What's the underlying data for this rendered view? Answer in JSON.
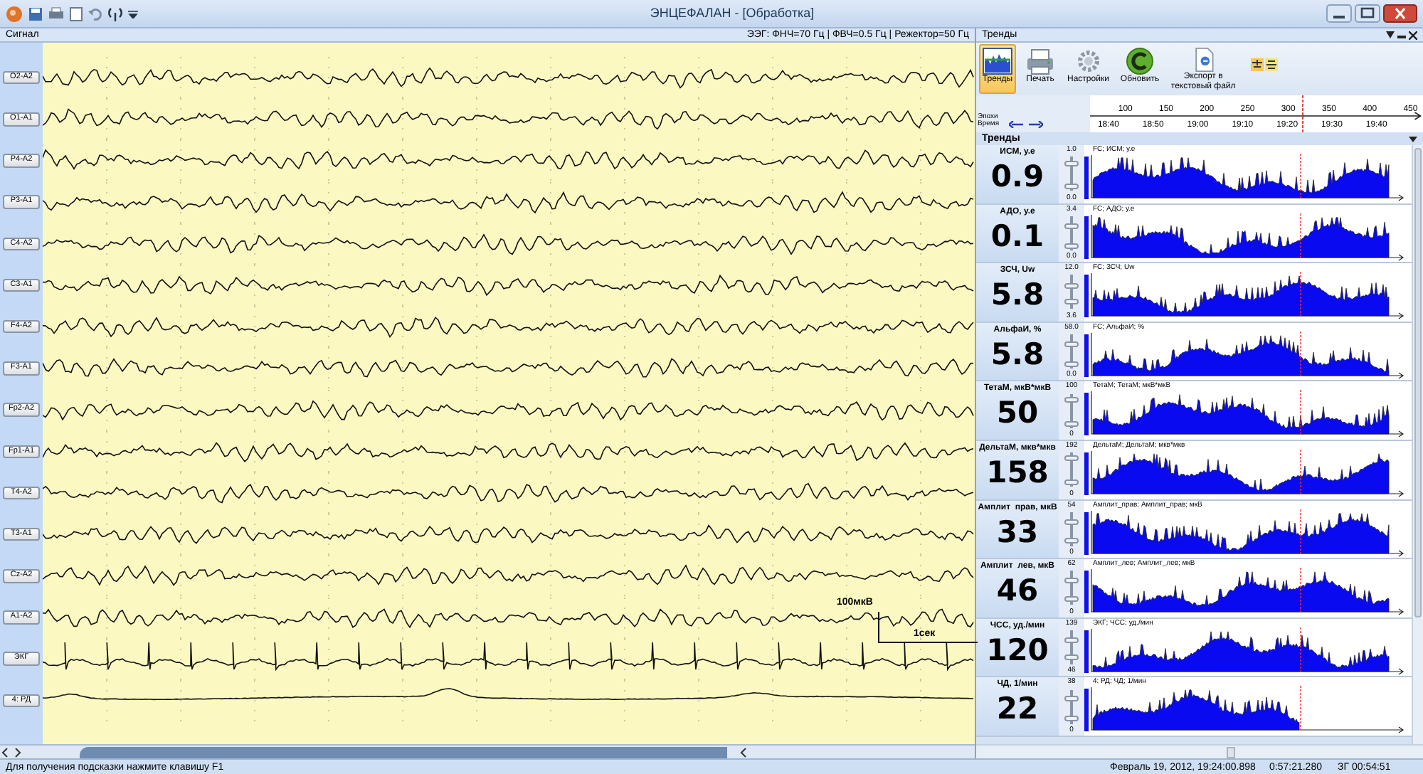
{
  "window": {
    "title": "ЭНЦЕФАЛАН - [Обработка]"
  },
  "signal_panel": {
    "title": "Сигнал",
    "filters": "ЭЭГ: ФНЧ=70 Гц | ФВЧ=0.5 Гц | Режектор=50 Гц",
    "channels": [
      {
        "label": "O2-A2",
        "kind": "eeg"
      },
      {
        "label": "O1-A1",
        "kind": "eeg"
      },
      {
        "label": "P4-A2",
        "kind": "eeg"
      },
      {
        "label": "P3-A1",
        "kind": "eeg"
      },
      {
        "label": "C4-A2",
        "kind": "eeg"
      },
      {
        "label": "C3-A1",
        "kind": "eeg"
      },
      {
        "label": "F4-A2",
        "kind": "eeg"
      },
      {
        "label": "F3-A1",
        "kind": "eeg"
      },
      {
        "label": "Fp2-A2",
        "kind": "eeg"
      },
      {
        "label": "Fp1-A1",
        "kind": "eeg"
      },
      {
        "label": "T4-A2",
        "kind": "eeg"
      },
      {
        "label": "T3-A1",
        "kind": "eeg"
      },
      {
        "label": "Cz-A2",
        "kind": "eeg"
      },
      {
        "label": "A1-A2",
        "kind": "eeg"
      },
      {
        "label": "ЭКГ",
        "kind": "ecg"
      },
      {
        "label": "4: РД",
        "kind": "resp"
      }
    ],
    "scale_amplitude": "100мкВ",
    "scale_time": "1сек"
  },
  "trends_panel": {
    "title": "Тренды",
    "toolbar": [
      {
        "label": "Тренды",
        "kind": "trends",
        "selected": true
      },
      {
        "label": "Печать",
        "kind": "print",
        "selected": false
      },
      {
        "label": "Настройки",
        "kind": "settings",
        "selected": false
      },
      {
        "label": "Обновить",
        "kind": "refresh",
        "selected": false
      },
      {
        "label": "Экспорт в текстовый файл",
        "kind": "export",
        "selected": false
      }
    ],
    "ruler": {
      "epochs_label": "Эпохи",
      "time_label": "Время",
      "epochs": [
        "100",
        "150",
        "200",
        "250",
        "300",
        "350",
        "400",
        "450"
      ],
      "times": [
        "18:40",
        "18:50",
        "19:00",
        "19:10",
        "19:20",
        "19:30",
        "19:40"
      ]
    },
    "section_title": "Тренды",
    "trends": [
      {
        "name": "ИСМ, у.е",
        "value": "0.9",
        "max": "1.0",
        "min": "0.0",
        "slider_high": {
          "level": 0.85
        },
        "slider_low": {
          "level": 0.05
        },
        "chart_title": "FC; ИСМ; у.е"
      },
      {
        "name": "АДО, у.е",
        "value": "0.1",
        "max": "3.4",
        "min": "0.0",
        "slider_high": {
          "level": 0.75
        },
        "slider_low": {
          "level": 0.05
        },
        "chart_title": "FC; АДО; у.е"
      },
      {
        "name": "ЗСЧ, Uw",
        "value": "5.8",
        "max": "12.0",
        "min": "3.6",
        "slider_high": {
          "level": 0.7
        },
        "slider_low": {
          "level": 0.15
        },
        "chart_title": "FC; ЗСЧ; Uw"
      },
      {
        "name": "АльфаИ, %",
        "value": "5.8",
        "max": "58.0",
        "min": "0.0",
        "slider_high": {
          "level": 0.75
        },
        "slider_low": {
          "level": 0.05
        },
        "chart_title": "FC; АльфаИ; %"
      },
      {
        "name": "ТетаМ, мкВ*мкВ",
        "value": "50",
        "max": "100",
        "min": "0",
        "slider_high": {
          "level": 0.9
        },
        "slider_low": {
          "level": 0.05
        },
        "chart_title": "ТетаМ; ТетаМ; мкВ*мкВ"
      },
      {
        "name": "ДельтаМ, мкв*мкв",
        "value": "158",
        "max": "192",
        "min": "0",
        "slider_high": {
          "level": 0.9
        },
        "slider_low": {
          "level": 0.05
        },
        "chart_title": "ДельтаМ; ДельтаМ; мкв*мкв"
      },
      {
        "name": "Амплит  прав, мкВ",
        "value": "33",
        "max": "54",
        "min": "0",
        "slider_high": {
          "level": 0.75
        },
        "slider_low": {
          "level": 0.1
        },
        "chart_title": "Амплит_прав; Амплит_прав; мкВ"
      },
      {
        "name": "Амплит  лев, мкВ",
        "value": "46",
        "max": "62",
        "min": "0",
        "slider_high": {
          "level": 0.75
        },
        "slider_low": {
          "level": 0.1
        },
        "chart_title": "Амплит_лев; Амплит_лев; мкВ"
      },
      {
        "name": "ЧСС, уд./мин",
        "value": "120",
        "max": "139",
        "min": "46",
        "slider_high": {
          "level": 0.75
        },
        "slider_low": {
          "level": 0.15
        },
        "chart_title": "ЭКГ; ЧСС; уд./мин"
      },
      {
        "name": "ЧД, 1/мин",
        "value": "22",
        "max": "38",
        "min": "0",
        "slider_high": {
          "level": 0.8
        },
        "slider_low": {
          "level": 0.1
        },
        "chart_title": "4: РД; ЧД; 1/мин"
      }
    ]
  },
  "status_bar": {
    "hint": "Для получения подсказки нажмите клавишу F1",
    "datetime": "Февраль 19, 2012, 19:24:00.898",
    "elapsed": "0:57:21.280",
    "position": "ЗГ 00:54:51"
  }
}
